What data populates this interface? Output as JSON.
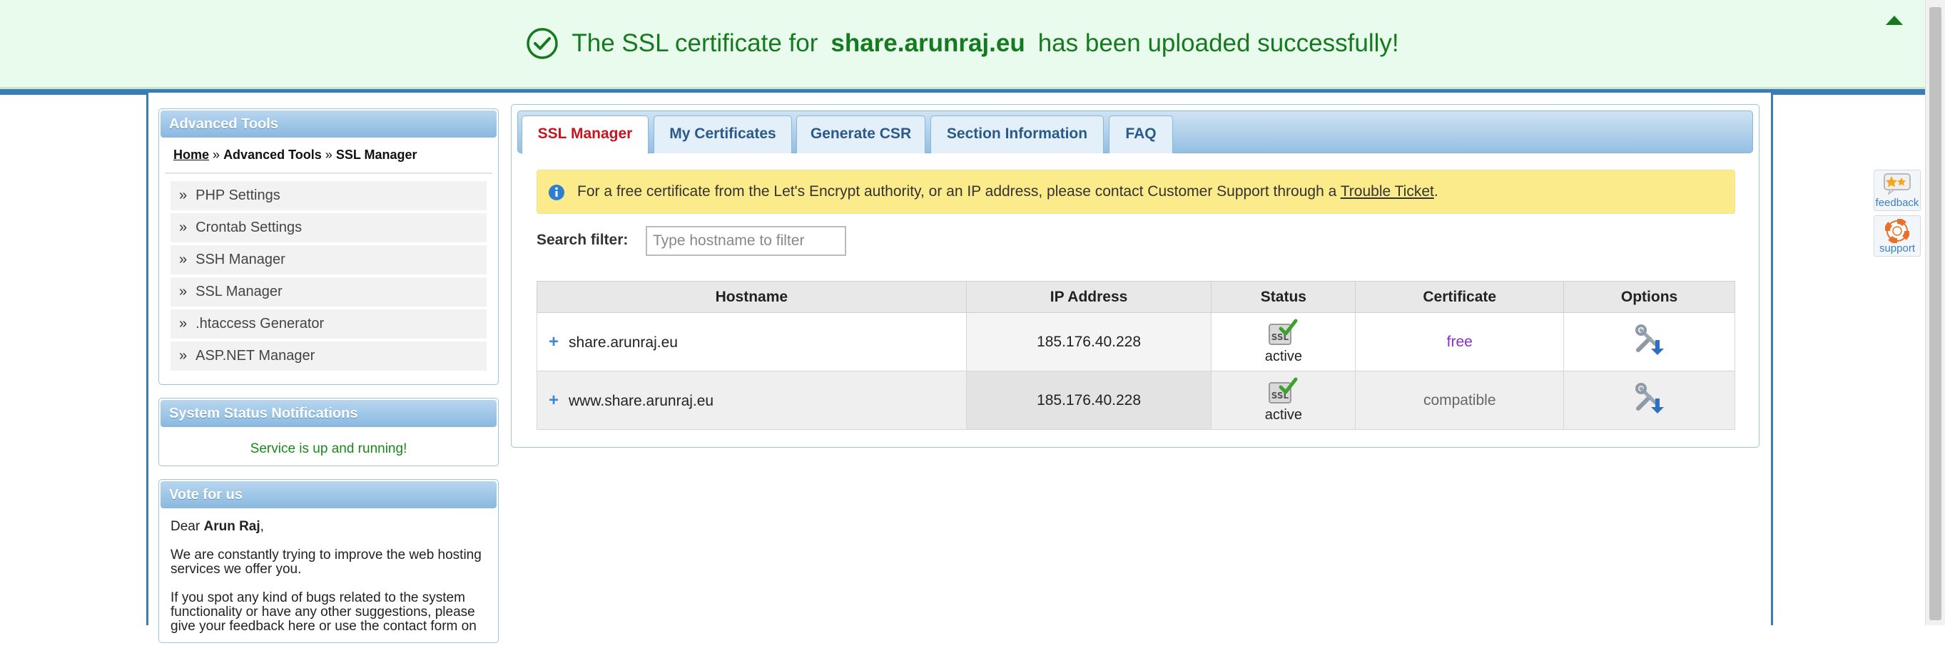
{
  "banner": {
    "prefix": "The SSL certificate for",
    "domain": "share.arunraj.eu",
    "suffix": "has been uploaded successfully!",
    "color": "#157a1f"
  },
  "sidebar": {
    "advanced_tools": {
      "title": "Advanced Tools",
      "breadcrumb": {
        "home": "Home",
        "sep1": "»",
        "section": "Advanced Tools",
        "sep2": "»",
        "current": "SSL Manager"
      },
      "items": [
        {
          "label": "PHP Settings"
        },
        {
          "label": "Crontab Settings"
        },
        {
          "label": "SSH Manager"
        },
        {
          "label": "SSL Manager"
        },
        {
          "label": ".htaccess Generator"
        },
        {
          "label": "ASP.NET Manager"
        }
      ],
      "bullet": "»"
    },
    "system_status": {
      "title": "System Status Notifications",
      "message": "Service is up and running!"
    },
    "vote": {
      "title": "Vote for us",
      "dear": "Dear",
      "name": "Arun Raj",
      "comma": ",",
      "p1": "We are constantly trying to improve the web hosting services we offer you.",
      "p2": "If you spot any kind of bugs related to the system functionality or have any other suggestions, please give your feedback here or use the contact form on"
    }
  },
  "main": {
    "tabs": [
      {
        "label": "SSL Manager",
        "active": true
      },
      {
        "label": "My Certificates",
        "active": false
      },
      {
        "label": "Generate CSR",
        "active": false
      },
      {
        "label": "Section Information",
        "active": false
      },
      {
        "label": "FAQ",
        "active": false
      }
    ],
    "notice": {
      "text": "For a free certificate from the Let's Encrypt authority, or an IP address, please contact Customer Support through a",
      "link": "Trouble Ticket",
      "end": "."
    },
    "search": {
      "label": "Search filter:",
      "placeholder": "Type hostname to filter",
      "value": ""
    },
    "table": {
      "headers": [
        "Hostname",
        "IP Address",
        "Status",
        "Certificate",
        "Options"
      ],
      "rows": [
        {
          "hostname": "share.arunraj.eu",
          "ip": "185.176.40.228",
          "status": "active",
          "certificate": "free"
        },
        {
          "hostname": "www.share.arunraj.eu",
          "ip": "185.176.40.228",
          "status": "active",
          "certificate": "compatible"
        }
      ],
      "expand_symbol": "+",
      "ssl_badge": "SSL"
    }
  },
  "side_buttons": {
    "feedback": "feedback",
    "support": "support"
  },
  "colors": {
    "accent": "#3a7cb6",
    "tab_active": "#c8141e",
    "success": "#168a19",
    "notice_bg": "#fbeb8b"
  }
}
